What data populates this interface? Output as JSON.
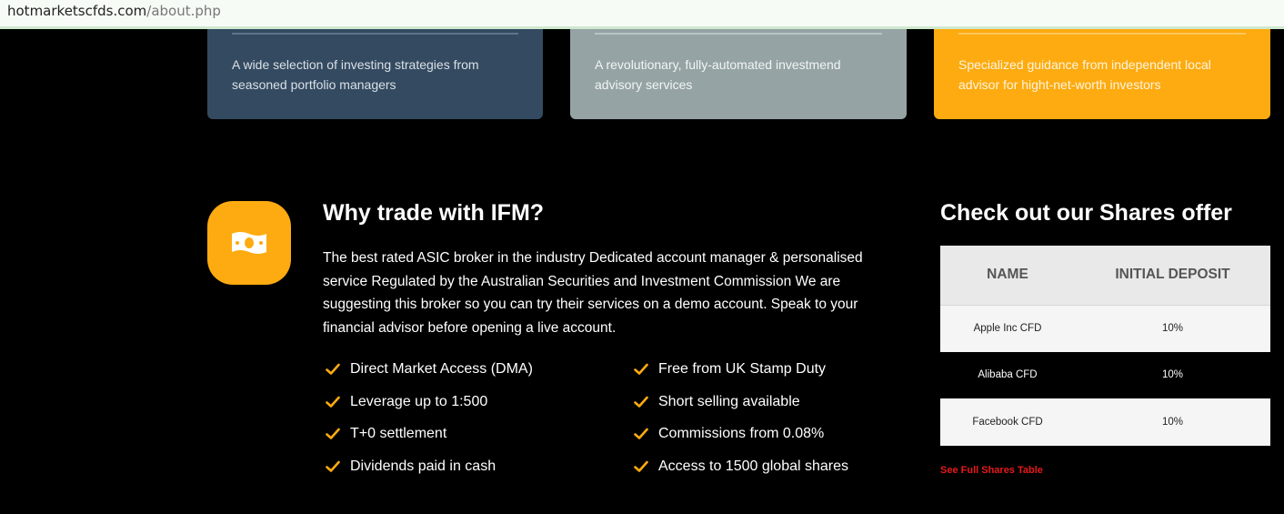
{
  "browser": {
    "url_host": "hotmarketscfds.com",
    "url_path": "/about.php"
  },
  "cards": [
    {
      "text": "A wide selection of investing strategies from seasoned portfolio managers"
    },
    {
      "text": "A revolutionary, fully-automated investmend advisory services"
    },
    {
      "text": "Specialized guidance from independent local advisor for hight-net-worth investors"
    }
  ],
  "why": {
    "icon": "money-bill-icon",
    "title": "Why trade with IFM?",
    "description": "The best rated ASIC broker in the industry Dedicated account manager & personalised service Regulated by the Australian Securities and Investment Commission We are suggesting this broker so you can try their services on a demo account. Speak to your financial advisor before opening a live account.",
    "features": [
      "Direct Market Access (DMA)",
      "Free from UK Stamp Duty",
      "Leverage up to 1:500",
      "Short selling available",
      "T+0 settlement",
      "Commissions from 0.08%",
      "Dividends paid in cash",
      "Access to 1500 global shares"
    ],
    "check_color": "#fdab10"
  },
  "shares": {
    "title": "Check out our Shares offer",
    "columns": [
      "NAME",
      "INITIAL DEPOSIT"
    ],
    "rows": [
      {
        "name": "Apple Inc CFD",
        "deposit": "10%"
      },
      {
        "name": "Alibaba CFD",
        "deposit": "10%"
      },
      {
        "name": "Facebook CFD",
        "deposit": "10%"
      }
    ],
    "link_label": "See Full Shares Table"
  },
  "colors": {
    "accent": "#fdab10",
    "link": "#e8191b"
  }
}
